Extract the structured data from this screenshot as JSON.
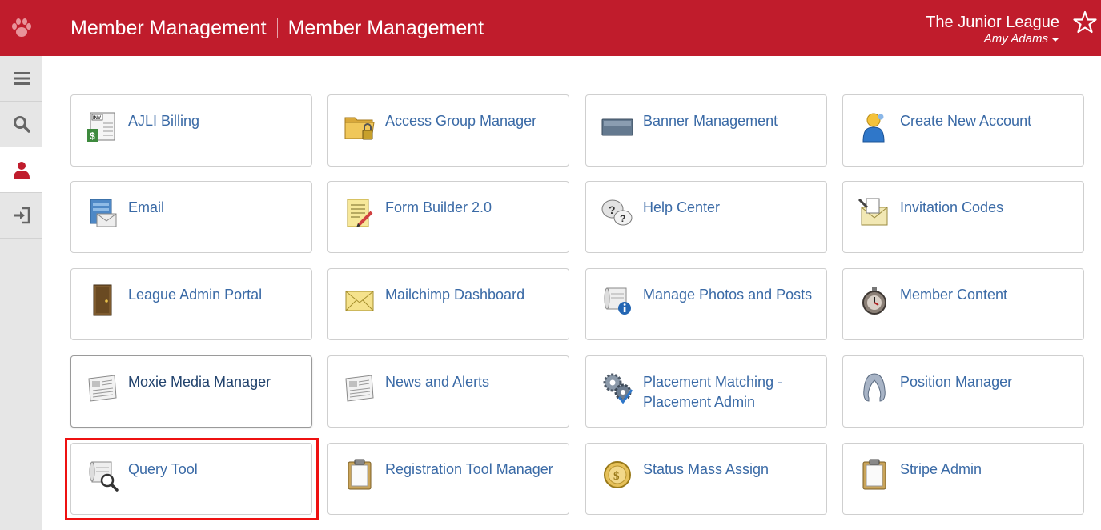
{
  "header": {
    "title_primary": "Member Management",
    "title_secondary": "Member Management",
    "org_name": "The Junior League",
    "user_name": "Amy Adams",
    "bg_color": "#c01c2c"
  },
  "sidebar": {
    "items": [
      {
        "icon": "menu-icon"
      },
      {
        "icon": "search-icon"
      },
      {
        "icon": "user-icon",
        "active": true
      },
      {
        "icon": "logout-icon"
      }
    ]
  },
  "tiles": [
    {
      "label": "AJLI Billing",
      "icon": "invoice-icon"
    },
    {
      "label": "Access Group Manager",
      "icon": "locked-folder-icon"
    },
    {
      "label": "Banner Management",
      "icon": "banner-icon"
    },
    {
      "label": "Create New Account",
      "icon": "new-user-icon"
    },
    {
      "label": "Email",
      "icon": "email-server-icon"
    },
    {
      "label": "Form Builder 2.0",
      "icon": "form-icon"
    },
    {
      "label": "Help Center",
      "icon": "help-bubbles-icon"
    },
    {
      "label": "Invitation Codes",
      "icon": "invitation-icon"
    },
    {
      "label": "League Admin Portal",
      "icon": "door-icon"
    },
    {
      "label": "Mailchimp Dashboard",
      "icon": "envelope-icon"
    },
    {
      "label": "Manage Photos and Posts",
      "icon": "scroll-info-icon"
    },
    {
      "label": "Member Content",
      "icon": "stopwatch-icon"
    },
    {
      "label": "Moxie Media Manager",
      "icon": "newspaper-icon",
      "hovered": true
    },
    {
      "label": "News and Alerts",
      "icon": "newspaper-icon"
    },
    {
      "label": "Placement Matching - Placement Admin",
      "icon": "gears-icon"
    },
    {
      "label": "Position Manager",
      "icon": "position-icon"
    },
    {
      "label": "Query Tool",
      "icon": "scroll-search-icon",
      "highlighted": true
    },
    {
      "label": "Registration Tool Manager",
      "icon": "clipboard-icon"
    },
    {
      "label": "Status Mass Assign",
      "icon": "coin-icon"
    },
    {
      "label": "Stripe Admin",
      "icon": "clipboard-icon"
    }
  ]
}
